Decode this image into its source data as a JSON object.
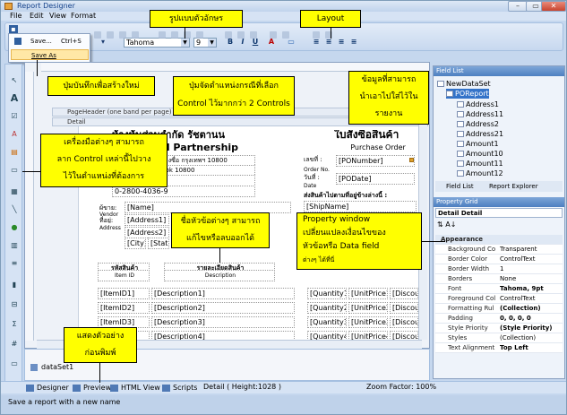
{
  "window": {
    "title": "Report Designer",
    "menu": [
      "File",
      "Edit",
      "View",
      "Format"
    ]
  },
  "toolbar": {
    "font_name": "Tahoma",
    "font_size": "9",
    "bold": "B",
    "italic": "I",
    "underline": "U"
  },
  "file_menu": {
    "save_label": "Save...",
    "save_shortcut": "Ctrl+S",
    "save_as_label": "Save As"
  },
  "canvas": {
    "page_header_band": "PageHeader (one band per page)",
    "detail_band": "Detail",
    "company_th": "ห้างหุ้นส่วนจำกัด รัชตานน",
    "company_en": "Limited Partnership",
    "address1": "แขวงบางซื่อ เขตบางซื่อ กรุงเทพฯ 10800",
    "address2": "Bangsue, Bangkok 10800",
    "phone": "0-2910 7936",
    "fax": "0-2800-4036-9",
    "doc_title_th": "ใบสั่งซื้อสินค้า",
    "doc_title_en": "Purchase Order",
    "po_no_th": "เลขที่ :",
    "po_no_en": "Order No.",
    "po_no_field": "[PONumber]",
    "po_date_th": "วันที่ :",
    "po_date_en": "Date",
    "po_date_field": "[PODate]",
    "ship_label": "ส่งสินค้าไปตามที่อยู่ข้างล่างนี้ :",
    "ship_field": "[ShipName]",
    "vendor_th": "ผู้ขาย:",
    "vendor_en": "Vendor",
    "address_th": "ที่อยู่:",
    "address_en": "Address",
    "name_field": "[Name]",
    "addr1_field": "[Address1]",
    "addr2_field": "[Address2]",
    "city_field": "[City]",
    "state_field": "[Stat",
    "col_item_th": "รหัสสินค้า",
    "col_item_en": "Item ID",
    "col_desc_th": "รายละเอียดสินค้า",
    "col_desc_en": "Description",
    "rows": [
      {
        "item": "[ItemID1]",
        "desc": "[Description1]",
        "qty": "[Quantity1]",
        "price": "[UnitPrice1]",
        "disc": "[Discou"
      },
      {
        "item": "[ItemID2]",
        "desc": "[Description2]",
        "qty": "[Quantity2]",
        "price": "[UnitPrice2]",
        "disc": "[Discou"
      },
      {
        "item": "[ItemID3]",
        "desc": "[Description3]",
        "qty": "[Quantity3]",
        "price": "[UnitPrice3]",
        "disc": "[Discou"
      },
      {
        "item": "[ItemID4]",
        "desc": "[Description4]",
        "qty": "[Quantity4]",
        "price": "[UnitPrice4]",
        "disc": "[Discou"
      }
    ]
  },
  "datasource": "dataSet1",
  "status_tabs": {
    "designer": "Designer",
    "preview": "Preview",
    "html_view": "HTML View",
    "scripts": "Scripts",
    "detail_info": "Detail ( Height:1028 )",
    "zoom": "Zoom Factor: 100%"
  },
  "status_message": "Save a report with a new name",
  "field_list": {
    "header": "Field List",
    "root": "NewDataSet",
    "table": "POReport",
    "fields": [
      "Address1",
      "Address11",
      "Address2",
      "Address21",
      "Amount1",
      "Amount10",
      "Amount11",
      "Amount12"
    ],
    "tab_field_list": "Field List",
    "tab_report_explorer": "Report Explorer"
  },
  "property_grid": {
    "header": "Property Grid",
    "object": "Detail  Detail",
    "group": "Appearance",
    "rows": [
      {
        "k": "Background Co",
        "v": "Transparent"
      },
      {
        "k": "Border Color",
        "v": "ControlText"
      },
      {
        "k": "Border Width",
        "v": "1"
      },
      {
        "k": "Borders",
        "v": "None"
      },
      {
        "k": "Font",
        "v": "Tahoma, 9pt"
      },
      {
        "k": "Foreground Col",
        "v": "ControlText"
      },
      {
        "k": "Formatting Rul",
        "v": "(Collection)"
      },
      {
        "k": "Padding",
        "v": "0, 0, 0, 0"
      },
      {
        "k": "Style Priority",
        "v": "(Style Priority)"
      },
      {
        "k": "Styles",
        "v": "(Collection)"
      },
      {
        "k": "Text Alignment",
        "v": "Top Left"
      }
    ]
  },
  "callouts": {
    "font_format": "รูปแบบตัวอักษร",
    "layout": "Layout",
    "save_new": "ปุ่มบันทึกเพื่อสร้างใหม่",
    "align_line1": "ปุ่มจัดตำแหน่งกรณีที่เลือก",
    "align_line2": "Control ไว้มากกว่า 2 Controls",
    "data_line1": "ข้อมูลที่สามารถ",
    "data_line2": "นำเอาไปใส่ไว้ใน",
    "data_line3": "รายงาน",
    "tools_line1": "เครื่องมือต่างๆ สามารถ",
    "tools_line2": "ลาก Control เหล่านี้ไปวาง",
    "tools_line3": "ไว้ในตำแหน่งที่ต้องการ",
    "header_line1": "ชื่อหัวข้อต่างๆ สามารถ",
    "header_line2": "แก้ไขหรือลบออกได้",
    "prop_line1": "Property window",
    "prop_line2": "เปลี่ยนแปลงเงื่อนไขของ",
    "prop_line3": "หัวข้อหรือ Data field",
    "prop_line4": "ต่างๆ ได้ที่นี่",
    "preview_line1": "แสดงตัวอย่าง",
    "preview_line2": "ก่อนพิมพ์"
  },
  "colors": {
    "callout": "#ffff00",
    "accent": "#3373c9",
    "frame": "#c5d7ee"
  }
}
